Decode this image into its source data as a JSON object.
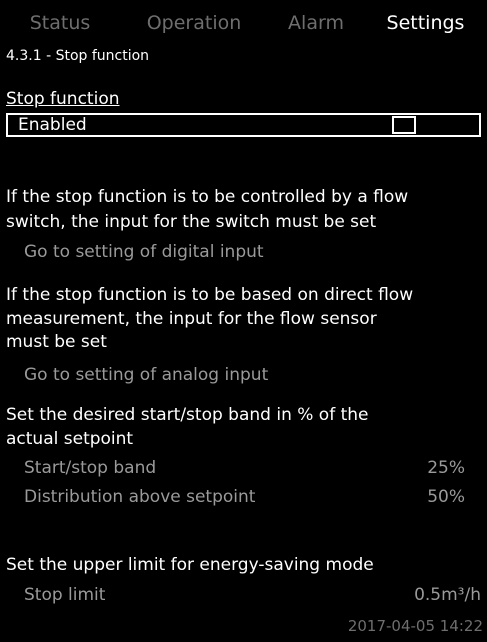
{
  "tabs": [
    {
      "label": "Status",
      "active": false
    },
    {
      "label": "Operation",
      "active": false
    },
    {
      "label": "Alarm",
      "active": false
    },
    {
      "label": "Settings",
      "active": true
    }
  ],
  "breadcrumb": "4.3.1 - Stop function",
  "stop_function": {
    "heading": "Stop function",
    "selected_label": "Enabled",
    "checked": false
  },
  "flow_switch": {
    "text_line1": "If the stop function is to be controlled by a flow",
    "text_line2": "switch, the input for the switch must be set",
    "link": "Go to setting of digital input"
  },
  "flow_measurement": {
    "text_line1": "If the stop function is to be based on direct flow",
    "text_line2": "measurement, the input for the flow sensor",
    "text_line3": "must be set",
    "link": "Go to setting of analog input"
  },
  "band": {
    "text_line1": "Set the desired start/stop band in % of the",
    "text_line2": "actual setpoint",
    "start_stop_label": "Start/stop band",
    "start_stop_value": "25%",
    "distribution_label": "Distribution above setpoint",
    "distribution_value": "50%"
  },
  "energy": {
    "text": "Set the upper limit for energy-saving mode",
    "stop_limit_label": "Stop limit",
    "stop_limit_value": "0.5m³/h"
  },
  "timestamp": "2017-04-05 14:22"
}
